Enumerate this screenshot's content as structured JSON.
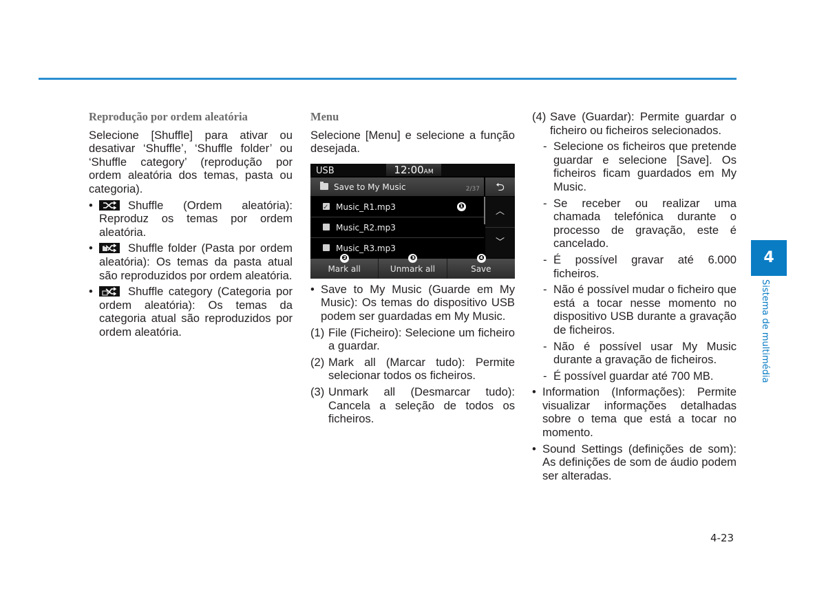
{
  "column1": {
    "heading": "Reprodução por ordem aleatória",
    "intro": "Selecione [Shuffle] para ativar ou desativar ‘Shuffle’, ‘Shuffle folder’ ou ‘Shuffle category’ (reprodução por ordem aleatória dos temas, pasta ou categoria).",
    "bullets": [
      {
        "icon": "shuffle-icon",
        "text": "Shuffle (Ordem aleatória): Reproduz os temas por ordem aleatória."
      },
      {
        "icon": "shuffle-folder-icon",
        "text": "Shuffle folder (Pasta por ordem aleatória): Os temas da pasta atual são reproduzidos por ordem aleatória."
      },
      {
        "icon": "shuffle-category-icon",
        "text": "Shuffle category (Categoria por ordem aleatória): Os temas da categoria atual são reproduzidos por ordem aleatória."
      }
    ]
  },
  "column2": {
    "heading": "Menu",
    "intro": "Selecione [Menu] e selecione a função desejada.",
    "screen": {
      "source": "USB",
      "clock": "12:00",
      "ampm": "AM",
      "title": "Save to My Music",
      "count": "2/37",
      "files": [
        {
          "name": "Music_R1.mp3",
          "checked": true
        },
        {
          "name": "Music_R2.mp3",
          "checked": false
        },
        {
          "name": "Music_R3.mp3",
          "checked": false
        }
      ],
      "callouts": [
        "❶",
        "❷",
        "❸",
        "❹"
      ],
      "buttons": [
        "Mark all",
        "Unmark all",
        "Save"
      ]
    },
    "bullet": "Save to My Music (Guarde em My Music): Os temas do dispositivo USB podem ser guardadas em My Music.",
    "items": [
      {
        "num": "(1)",
        "text": "File (Ficheiro): Selecione um ficheiro a guardar."
      },
      {
        "num": "(2)",
        "text": "Mark all (Marcar tudo): Permite selecionar todos os ficheiros."
      },
      {
        "num": "(3)",
        "text": "Unmark all (Desmarcar tudo): Cancela a seleção de todos os ficheiros."
      }
    ]
  },
  "column3": {
    "item4": {
      "num": "(4)",
      "text": "Save (Guardar): Permite guardar o ficheiro ou ficheiros selecionados."
    },
    "dashes": [
      "Selecione os ficheiros que pretende guardar e selecione [Save]. Os ficheiros ficam guardados em My Music.",
      "Se receber ou realizar uma chamada telefónica durante o processo de gravação, este é cancelado.",
      "É possível gravar até 6.000 ficheiros.",
      "Não é possível mudar o ficheiro que está a tocar nesse momento no dispositivo USB durante a gravação de ficheiros.",
      "Não é possível usar My Music durante a gravação de ficheiros.",
      "É possível guardar até 700 MB."
    ],
    "bullets": [
      "Information (Informações): Permite visualizar informações detalhadas sobre o tema que está a tocar no momento.",
      "Sound Settings (definições de som): As definições de som de áudio podem ser alteradas."
    ]
  },
  "side": {
    "chapter": "4",
    "label": "Sistema de multimédia",
    "accent": "#0a7cc4"
  },
  "page_number": "4-23",
  "rule_color": "#2a8fd0"
}
